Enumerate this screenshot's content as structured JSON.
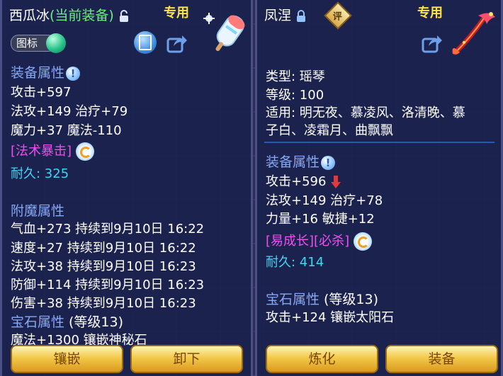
{
  "left": {
    "title_name": "西瓜冰",
    "title_status": "(当前装备)",
    "special": "专用",
    "icon_label": "图标",
    "equip_attr_title": "装备属性",
    "attrs": [
      "攻击+597",
      "法攻+149 治疗+79",
      "魔力+37 魔法-110"
    ],
    "skill": "[法术暴击]",
    "durability": "耐久: 325",
    "enchant_title": "附魔属性",
    "enchants": [
      "气血+273 持续到9月10日 16:22",
      "速度+27 持续到9月10日 16:22",
      "法攻+38 持续到9月10日 16:23",
      "防御+114 持续到9月10日 16:23",
      "伤害+38 持续到9月10日 16:23"
    ],
    "gem_title": "宝石属性",
    "gem_level": "(等级13)",
    "gem_line": "魔法+1300 镶嵌神秘石",
    "buttons": [
      "镶嵌",
      "卸下"
    ]
  },
  "right": {
    "title_name": "凤涅",
    "rate_icon_text": "评",
    "special": "专用",
    "info": [
      "类型: 瑶琴",
      "等级: 100",
      "适用: 明无夜、慕凌风、洛清晚、慕",
      "子白、凌霜月、曲飘飘"
    ],
    "equip_attr_title": "装备属性",
    "attrs": [
      "攻击+596",
      "法攻+149 治疗+78",
      "力量+16 敏捷+12"
    ],
    "skill": "[易成长][必杀]",
    "durability": "耐久: 414",
    "gem_title": "宝石属性",
    "gem_level": "(等级13)",
    "gem_line": "攻击+124 镶嵌太阳石",
    "buttons": [
      "炼化",
      "装备"
    ]
  },
  "colors": {
    "panel_bg": "#1c224e",
    "section": "#86a8f2",
    "green": "#6cf07a",
    "magenta": "#ee50ee",
    "cyan": "#40d6f2",
    "gold": "#ffe14a",
    "down_arrow": "#e23a3a"
  },
  "icons": [
    "lock-open-icon",
    "lock-icon",
    "rate-badge-icon",
    "green-orb-icon",
    "blue-card-icon",
    "share-icon",
    "info-icon",
    "refresh-icon",
    "down-arrow-icon",
    "popsicle-weapon-icon",
    "phoenix-zither-icon"
  ]
}
